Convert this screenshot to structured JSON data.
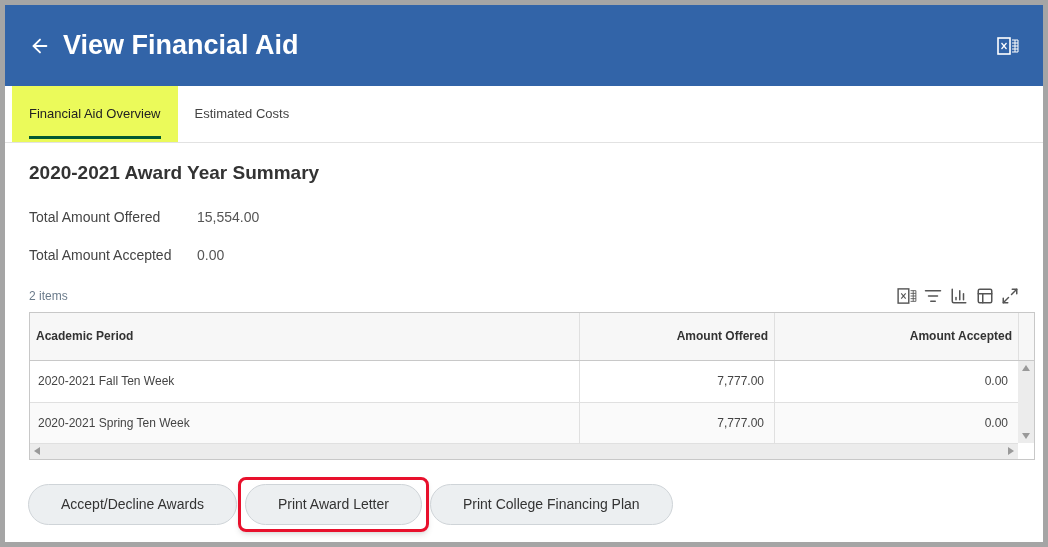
{
  "header": {
    "title": "View Financial Aid"
  },
  "tabs": [
    {
      "label": "Financial Aid Overview",
      "selected": true,
      "highlighted": true
    },
    {
      "label": "Estimated Costs",
      "selected": false,
      "highlighted": false
    }
  ],
  "summary": {
    "title": "2020-2021 Award Year Summary",
    "fields": [
      {
        "label": "Total Amount Offered",
        "value": "15,554.00"
      },
      {
        "label": "Total Amount Accepted",
        "value": "0.00"
      }
    ]
  },
  "table": {
    "count": "2 items",
    "columns": [
      "Academic Period",
      "Amount Offered",
      "Amount Accepted"
    ],
    "rows": [
      [
        "2020-2021 Fall Ten Week",
        "7,777.00",
        "0.00"
      ],
      [
        "2020-2021 Spring Ten Week",
        "7,777.00",
        "0.00"
      ]
    ]
  },
  "buttons": [
    {
      "label": "Accept/Decline Awards",
      "highlighted": false
    },
    {
      "label": "Print Award Letter",
      "highlighted": true
    },
    {
      "label": "Print College Financing Plan",
      "highlighted": false
    }
  ]
}
